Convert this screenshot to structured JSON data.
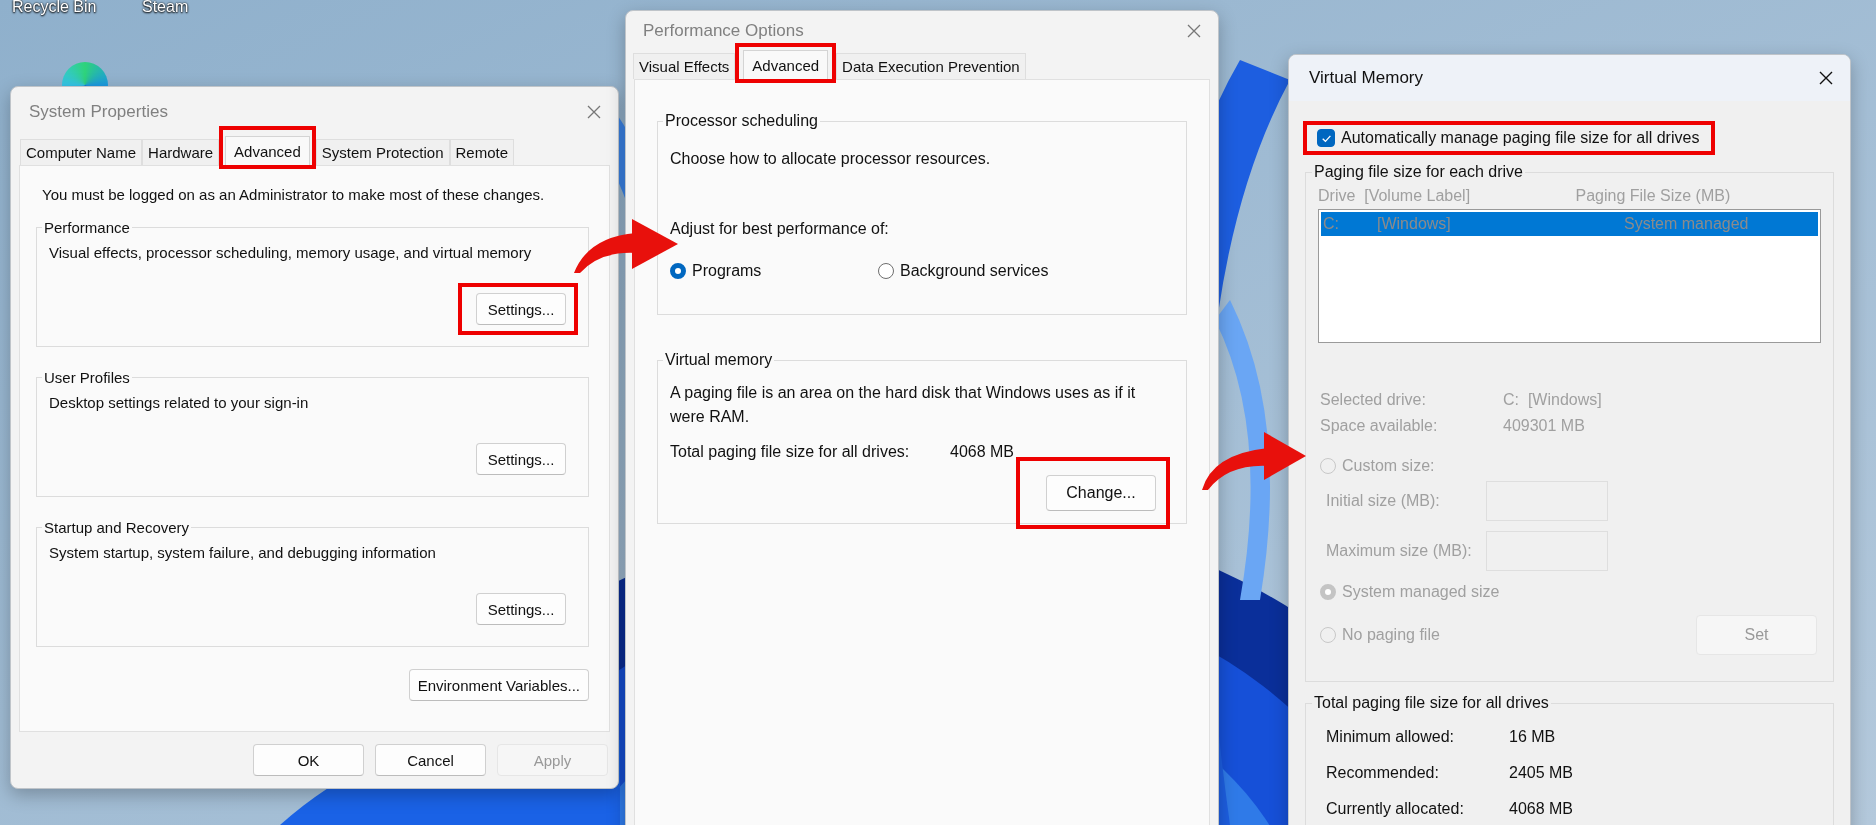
{
  "desktop": {
    "icons": [
      {
        "label": "Recycle Bin"
      },
      {
        "label": "Steam"
      }
    ]
  },
  "system_properties": {
    "title": "System Properties",
    "tabs": [
      {
        "label": "Computer Name",
        "selected": false,
        "highlighted": false
      },
      {
        "label": "Hardware",
        "selected": false,
        "highlighted": false
      },
      {
        "label": "Advanced",
        "selected": true,
        "highlighted": true
      },
      {
        "label": "System Protection",
        "selected": false,
        "highlighted": false
      },
      {
        "label": "Remote",
        "selected": false,
        "highlighted": false
      }
    ],
    "note": "You must be logged on as an Administrator to make most of these changes.",
    "groups": [
      {
        "title": "Performance",
        "description": "Visual effects, processor scheduling, memory usage, and virtual memory",
        "button": {
          "label": "Settings...",
          "highlighted": true
        }
      },
      {
        "title": "User Profiles",
        "description": "Desktop settings related to your sign-in",
        "button": {
          "label": "Settings...",
          "highlighted": false
        }
      },
      {
        "title": "Startup and Recovery",
        "description": "System startup, system failure, and debugging information",
        "button": {
          "label": "Settings...",
          "highlighted": false
        }
      }
    ],
    "env_button": {
      "label": "Environment Variables..."
    },
    "buttons": [
      {
        "label": "OK",
        "disabled": false
      },
      {
        "label": "Cancel",
        "disabled": false
      },
      {
        "label": "Apply",
        "disabled": true
      }
    ]
  },
  "performance_options": {
    "title": "Performance Options",
    "tabs": [
      {
        "label": "Visual Effects",
        "selected": false,
        "highlighted": false
      },
      {
        "label": "Advanced",
        "selected": true,
        "highlighted": true
      },
      {
        "label": "Data Execution Prevention",
        "selected": false,
        "highlighted": false
      }
    ],
    "processor_scheduling": {
      "title": "Processor scheduling",
      "description": "Choose how to allocate processor resources.",
      "prompt": "Adjust for best performance of:",
      "options": [
        {
          "label": "Programs",
          "selected": true
        },
        {
          "label": "Background services",
          "selected": false
        }
      ]
    },
    "virtual_memory": {
      "title": "Virtual memory",
      "description": "A paging file is an area on the hard disk that Windows uses as if it were RAM.",
      "total_label": "Total paging file size for all drives:",
      "total_value": "4068 MB",
      "button": {
        "label": "Change...",
        "highlighted": true
      }
    }
  },
  "virtual_memory": {
    "title": "Virtual Memory",
    "auto_manage": {
      "label": "Automatically manage paging file size for all drives",
      "checked": true,
      "highlighted": true
    },
    "drives_group": {
      "title": "Paging file size for each drive",
      "disabled": true,
      "columns": [
        "Drive  [Volume Label]",
        "Paging File Size (MB)"
      ],
      "rows": [
        {
          "drive": "C:",
          "volume": "[Windows]",
          "size": "System managed",
          "selected": true
        }
      ],
      "info": [
        {
          "label": "Selected drive:",
          "value": "C:  [Windows]"
        },
        {
          "label": "Space available:",
          "value": "409301 MB"
        }
      ],
      "size_options": [
        {
          "label": "Custom size:",
          "selected": false
        },
        {
          "label": "System managed size",
          "selected": true
        },
        {
          "label": "No paging file",
          "selected": false
        }
      ],
      "fields": [
        {
          "label": "Initial size (MB):"
        },
        {
          "label": "Maximum size (MB):"
        }
      ],
      "set_button": {
        "label": "Set",
        "disabled": true
      }
    },
    "totals": {
      "title": "Total paging file size for all drives",
      "rows": [
        {
          "label": "Minimum allowed:",
          "value": "16 MB"
        },
        {
          "label": "Recommended:",
          "value": "2405 MB"
        },
        {
          "label": "Currently allocated:",
          "value": "4068 MB"
        }
      ]
    }
  }
}
